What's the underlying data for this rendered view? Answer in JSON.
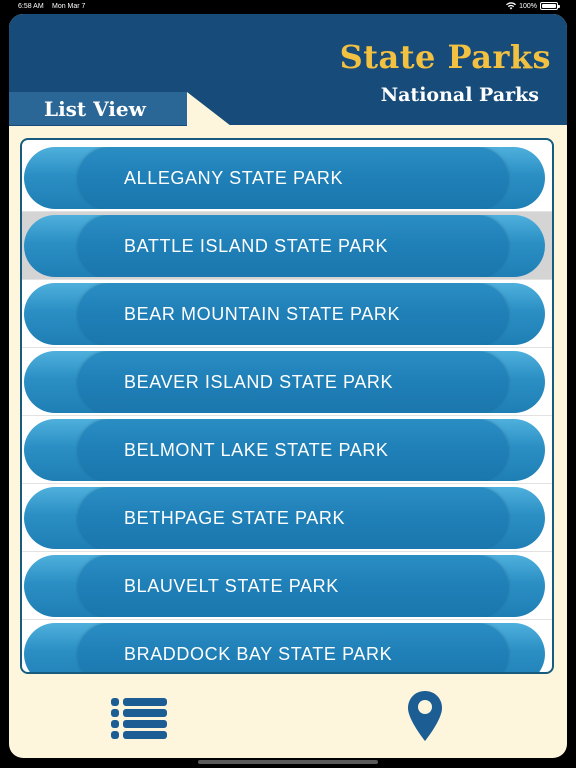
{
  "status_bar": {
    "time": "6:58 AM",
    "date": "Mon Mar 7",
    "battery": "100%"
  },
  "header": {
    "title": "State Parks",
    "subtitle": "National Parks",
    "tab_label": "List View"
  },
  "parks": [
    {
      "name": "ALLEGANY STATE PARK",
      "selected": false
    },
    {
      "name": "BATTLE ISLAND STATE PARK",
      "selected": true
    },
    {
      "name": "BEAR MOUNTAIN STATE PARK",
      "selected": false
    },
    {
      "name": "BEAVER ISLAND STATE PARK",
      "selected": false
    },
    {
      "name": "BELMONT LAKE STATE PARK",
      "selected": false
    },
    {
      "name": "BETHPAGE STATE PARK",
      "selected": false
    },
    {
      "name": "BLAUVELT STATE PARK",
      "selected": false
    },
    {
      "name": "BRADDOCK BAY STATE PARK",
      "selected": false
    }
  ],
  "toolbar": {
    "list_icon": "list-icon",
    "map_icon": "map-pin-icon"
  },
  "colors": {
    "header_bg": "#174c7a",
    "title_gold": "#f2c142",
    "tab_bg": "#2a6796",
    "cream": "#fdf6dc",
    "pill_blue": "#2b8fc4",
    "icon_blue": "#1c5d93"
  }
}
